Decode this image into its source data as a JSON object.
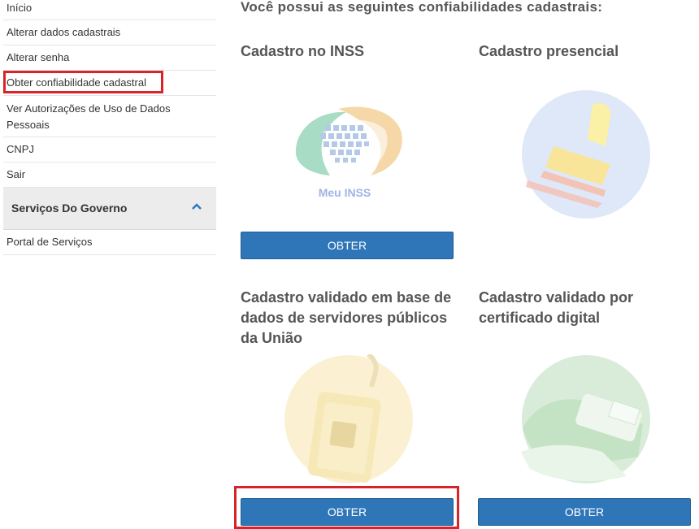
{
  "sidebar": {
    "items": [
      {
        "label": "Início"
      },
      {
        "label": "Alterar dados cadastrais"
      },
      {
        "label": "Alterar senha"
      },
      {
        "label": "Obter confiabilidade cadastral"
      },
      {
        "label": "Ver Autorizações de Uso de Dados Pessoais"
      },
      {
        "label": "CNPJ"
      },
      {
        "label": "Sair"
      }
    ],
    "section": {
      "title": "Serviços Do Governo",
      "items": [
        {
          "label": "Portal de Serviços"
        }
      ]
    }
  },
  "main": {
    "title": "Você possui as seguintes confiabilidades cadastrais:",
    "cards": [
      {
        "title": "Cadastro no INSS",
        "logo_text": "Meu INSS",
        "button": "OBTER"
      },
      {
        "title": "Cadastro presencial"
      },
      {
        "title": "Cadastro validado em base de dados de servidores públicos da União",
        "button": "OBTER"
      },
      {
        "title": "Cadastro validado por certificado digital",
        "button": "OBTER"
      }
    ]
  },
  "colors": {
    "primary_button": "#2f76b9",
    "highlight": "#d8232a"
  }
}
